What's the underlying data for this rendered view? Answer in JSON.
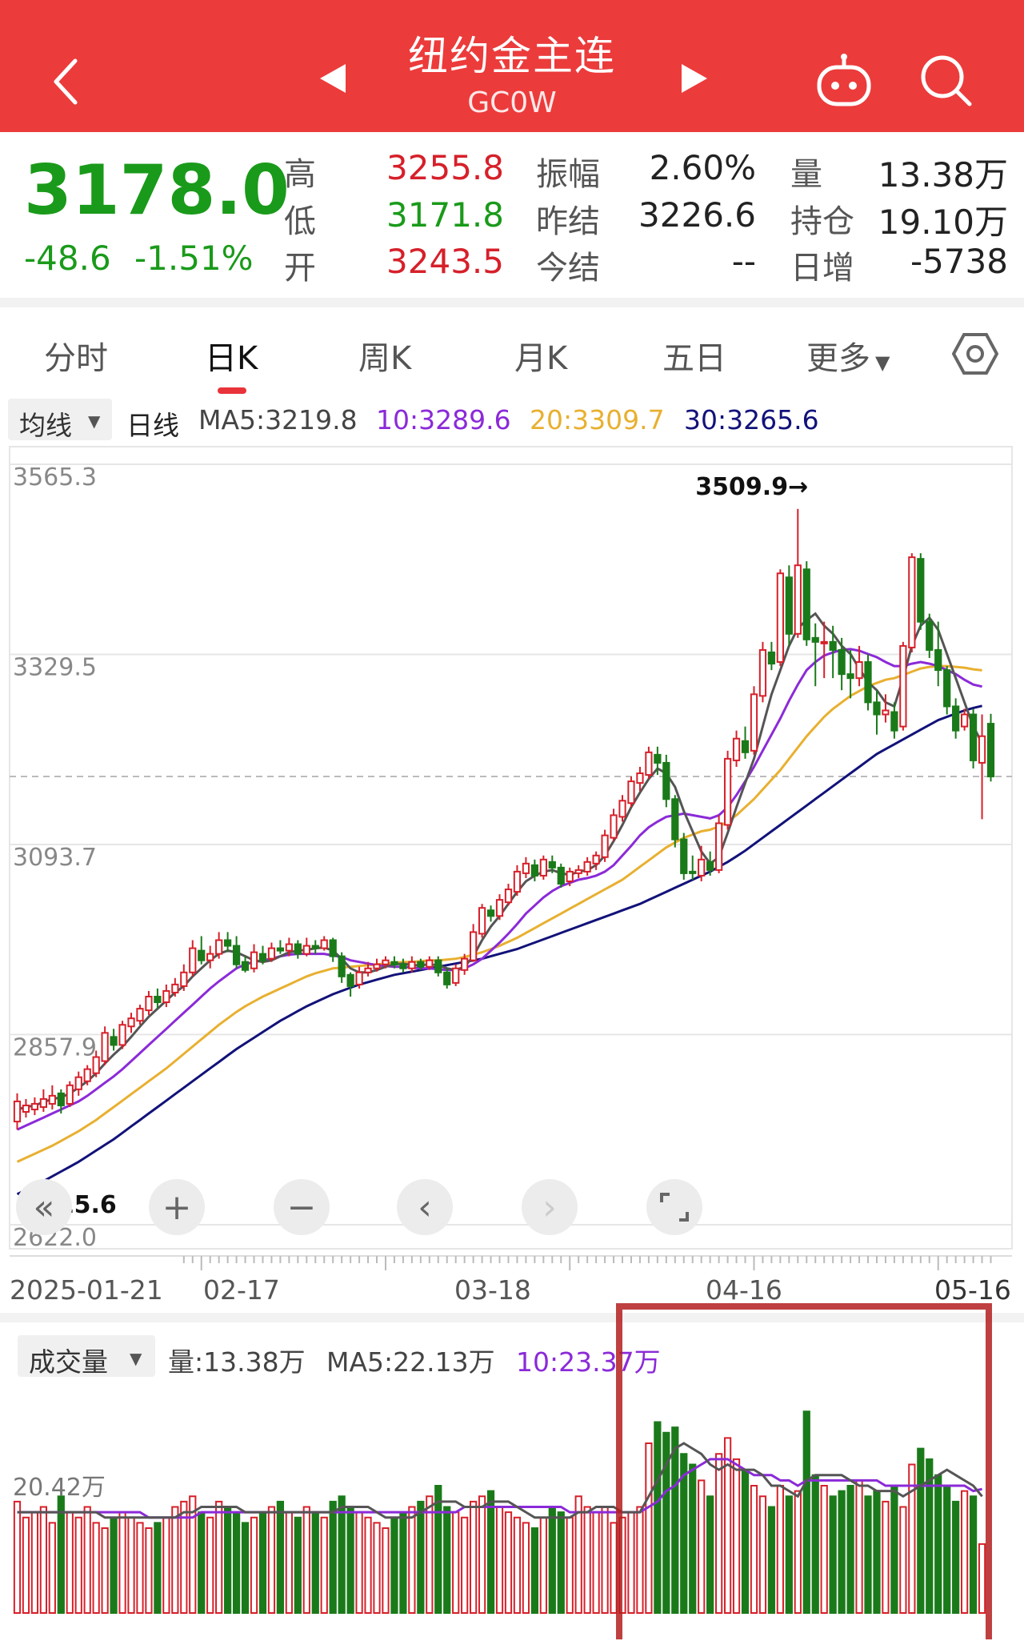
{
  "header": {
    "title": "纽约金主连",
    "code": "GC0W",
    "icons": [
      "back-icon",
      "prev-icon",
      "next-icon",
      "robot-icon",
      "search-icon"
    ]
  },
  "quote": {
    "price": "3178.0",
    "change": "-48.6",
    "change_pct": "-1.51%",
    "col1": [
      {
        "label": "高",
        "value": "3255.8",
        "color": "red"
      },
      {
        "label": "低",
        "value": "3171.8",
        "color": "green"
      },
      {
        "label": "开",
        "value": "3243.5",
        "color": "red"
      }
    ],
    "col2": [
      {
        "label": "振幅",
        "value": "2.60%"
      },
      {
        "label": "昨结",
        "value": "3226.6"
      },
      {
        "label": "今结",
        "value": "--"
      }
    ],
    "col3": [
      {
        "label": "量",
        "value": "13.38万"
      },
      {
        "label": "持仓",
        "value": "19.10万"
      },
      {
        "label": "日增",
        "value": "-5738"
      }
    ]
  },
  "tabs": [
    "分时",
    "日K",
    "周K",
    "月K",
    "五日",
    "更多"
  ],
  "active_tab": "日K",
  "ma_legend": {
    "selector": "均线",
    "period": "日线",
    "ma5": "MA5:3219.8",
    "ma10": "10:3289.6",
    "ma20": "20:3309.7",
    "ma30": "30:3265.6"
  },
  "colors": {
    "up": "#d6202a",
    "down": "#1a7a1a",
    "ma5": "#555555",
    "ma10": "#8b2ad8",
    "ma20": "#e8b030",
    "ma30": "#12127a",
    "header": "#ec3b3b"
  },
  "controls": [
    "rewind-icon",
    "zoom-in-icon",
    "zoom-out-icon",
    "left-icon",
    "right-icon",
    "fullscreen-icon"
  ],
  "volume_legend": {
    "selector": "成交量",
    "vol": "量:13.38万",
    "ma5": "MA5:22.13万",
    "ma10": "10:23.37万"
  },
  "chart_data": {
    "type": "candlestick",
    "y_ticks": [
      "3565.3",
      "3329.5",
      "3093.7",
      "2857.9",
      "2622.0"
    ],
    "ylim": [
      2622.0,
      3565.3
    ],
    "max_label": "3509.9→",
    "min_label": "2715.6",
    "last_close": 3178.0,
    "x_ticks": [
      "2025-01-21",
      "02-17",
      "03-18",
      "04-16",
      "05-16"
    ],
    "vol_axis_label": "20.42万",
    "candles": [
      [
        2750,
        2775,
        2740,
        2785
      ],
      [
        2762,
        2770,
        2755,
        2778
      ],
      [
        2765,
        2772,
        2758,
        2780
      ],
      [
        2768,
        2778,
        2762,
        2790
      ],
      [
        2772,
        2782,
        2765,
        2795
      ],
      [
        2785,
        2770,
        2760,
        2790
      ],
      [
        2772,
        2795,
        2768,
        2800
      ],
      [
        2790,
        2805,
        2782,
        2812
      ],
      [
        2800,
        2815,
        2795,
        2820
      ],
      [
        2810,
        2830,
        2805,
        2838
      ],
      [
        2825,
        2860,
        2820,
        2868
      ],
      [
        2855,
        2845,
        2838,
        2865
      ],
      [
        2845,
        2870,
        2840,
        2875
      ],
      [
        2868,
        2878,
        2860,
        2885
      ],
      [
        2875,
        2890,
        2870,
        2895
      ],
      [
        2888,
        2905,
        2882,
        2912
      ],
      [
        2905,
        2898,
        2890,
        2915
      ],
      [
        2898,
        2912,
        2892,
        2920
      ],
      [
        2910,
        2920,
        2905,
        2928
      ],
      [
        2918,
        2935,
        2912,
        2945
      ],
      [
        2935,
        2965,
        2930,
        2975
      ],
      [
        2962,
        2950,
        2945,
        2980
      ],
      [
        2950,
        2958,
        2940,
        2968
      ],
      [
        2958,
        2975,
        2952,
        2985
      ],
      [
        2975,
        2968,
        2960,
        2985
      ],
      [
        2968,
        2945,
        2940,
        2980
      ],
      [
        2948,
        2938,
        2935,
        2955
      ],
      [
        2940,
        2960,
        2935,
        2970
      ],
      [
        2958,
        2950,
        2945,
        2968
      ],
      [
        2952,
        2965,
        2948,
        2972
      ],
      [
        2965,
        2962,
        2958,
        2975
      ],
      [
        2962,
        2970,
        2955,
        2978
      ],
      [
        2970,
        2958,
        2952,
        2975
      ],
      [
        2958,
        2968,
        2955,
        2978
      ],
      [
        2968,
        2965,
        2958,
        2975
      ],
      [
        2965,
        2975,
        2962,
        2980
      ],
      [
        2975,
        2955,
        2948,
        2978
      ],
      [
        2955,
        2930,
        2922,
        2960
      ],
      [
        2932,
        2918,
        2905,
        2935
      ],
      [
        2920,
        2935,
        2915,
        2942
      ],
      [
        2935,
        2940,
        2930,
        2948
      ],
      [
        2940,
        2945,
        2936,
        2952
      ],
      [
        2945,
        2950,
        2940,
        2955
      ],
      [
        2948,
        2945,
        2940,
        2955
      ],
      [
        2945,
        2940,
        2935,
        2952
      ],
      [
        2940,
        2948,
        2935,
        2955
      ],
      [
        2948,
        2942,
        2938,
        2952
      ],
      [
        2942,
        2950,
        2938,
        2955
      ],
      [
        2950,
        2935,
        2930,
        2955
      ],
      [
        2935,
        2920,
        2915,
        2940
      ],
      [
        2922,
        2940,
        2918,
        2945
      ],
      [
        2938,
        2952,
        2932,
        2958
      ],
      [
        2950,
        2985,
        2948,
        2995
      ],
      [
        2983,
        3015,
        2978,
        3020
      ],
      [
        3012,
        3005,
        2998,
        3018
      ],
      [
        3005,
        3025,
        3000,
        3032
      ],
      [
        3022,
        3038,
        3018,
        3045
      ],
      [
        3035,
        3060,
        3030,
        3068
      ],
      [
        3058,
        3070,
        3052,
        3078
      ],
      [
        3068,
        3055,
        3048,
        3075
      ],
      [
        3055,
        3075,
        3050,
        3080
      ],
      [
        3072,
        3065,
        3058,
        3080
      ],
      [
        3065,
        3045,
        3040,
        3070
      ],
      [
        3048,
        3060,
        3042,
        3065
      ],
      [
        3058,
        3062,
        3052,
        3068
      ],
      [
        3060,
        3072,
        3055,
        3078
      ],
      [
        3070,
        3080,
        3062,
        3085
      ],
      [
        3078,
        3105,
        3072,
        3112
      ],
      [
        3102,
        3130,
        3098,
        3138
      ],
      [
        3128,
        3148,
        3122,
        3155
      ],
      [
        3145,
        3172,
        3140,
        3178
      ],
      [
        3170,
        3182,
        3160,
        3190
      ],
      [
        3180,
        3208,
        3175,
        3215
      ],
      [
        3205,
        3195,
        3180,
        3215
      ],
      [
        3195,
        3150,
        3140,
        3205
      ],
      [
        3150,
        3100,
        3090,
        3155
      ],
      [
        3100,
        3058,
        3050,
        3108
      ],
      [
        3060,
        3058,
        3050,
        3080
      ],
      [
        3055,
        3075,
        3048,
        3092
      ],
      [
        3072,
        3062,
        3055,
        3085
      ],
      [
        3062,
        3120,
        3058,
        3130
      ],
      [
        3118,
        3200,
        3112,
        3210
      ],
      [
        3198,
        3225,
        3190,
        3235
      ],
      [
        3222,
        3208,
        3200,
        3240
      ],
      [
        3210,
        3280,
        3205,
        3290
      ],
      [
        3278,
        3335,
        3270,
        3345
      ],
      [
        3332,
        3318,
        3310,
        3345
      ],
      [
        3320,
        3430,
        3315,
        3435
      ],
      [
        3425,
        3355,
        3340,
        3440
      ],
      [
        3355,
        3440,
        3350,
        3509.9
      ],
      [
        3435,
        3348,
        3340,
        3445
      ],
      [
        3350,
        3345,
        3290,
        3368
      ],
      [
        3345,
        3345,
        3300,
        3370
      ],
      [
        3345,
        3335,
        3300,
        3365
      ],
      [
        3335,
        3305,
        3285,
        3350
      ],
      [
        3305,
        3300,
        3275,
        3335
      ],
      [
        3300,
        3320,
        3290,
        3340
      ],
      [
        3320,
        3270,
        3260,
        3330
      ],
      [
        3270,
        3255,
        3230,
        3285
      ],
      [
        3255,
        3260,
        3245,
        3280
      ],
      [
        3258,
        3235,
        3225,
        3270
      ],
      [
        3240,
        3340,
        3235,
        3345
      ],
      [
        3338,
        3450,
        3332,
        3455
      ],
      [
        3448,
        3370,
        3360,
        3455
      ],
      [
        3370,
        3335,
        3325,
        3380
      ],
      [
        3335,
        3310,
        3290,
        3370
      ],
      [
        3310,
        3265,
        3255,
        3315
      ],
      [
        3265,
        3235,
        3225,
        3275
      ],
      [
        3240,
        3255,
        3235,
        3262
      ],
      [
        3255,
        3198,
        3188,
        3262
      ],
      [
        3195,
        3228,
        3125,
        3255
      ],
      [
        3243.5,
        3178,
        3171.8,
        3255.8
      ]
    ],
    "ma5": [
      2765,
      2768,
      2770,
      2774,
      2778,
      2780,
      2785,
      2792,
      2800,
      2810,
      2822,
      2833,
      2843,
      2855,
      2868,
      2880,
      2890,
      2900,
      2910,
      2918,
      2930,
      2940,
      2950,
      2958,
      2962,
      2960,
      2955,
      2950,
      2948,
      2950,
      2955,
      2960,
      2962,
      2963,
      2965,
      2966,
      2962,
      2952,
      2940,
      2935,
      2935,
      2938,
      2942,
      2945,
      2946,
      2944,
      2944,
      2945,
      2944,
      2940,
      2938,
      2942,
      2955,
      2975,
      2992,
      3005,
      3020,
      3035,
      3048,
      3055,
      3060,
      3062,
      3058,
      3056,
      3060,
      3062,
      3068,
      3080,
      3098,
      3118,
      3140,
      3158,
      3175,
      3188,
      3182,
      3165,
      3135,
      3110,
      3085,
      3070,
      3078,
      3108,
      3140,
      3170,
      3200,
      3240,
      3280,
      3310,
      3340,
      3362,
      3372,
      3380,
      3365,
      3355,
      3340,
      3330,
      3312,
      3295,
      3285,
      3270,
      3265,
      3300,
      3340,
      3365,
      3375,
      3360,
      3330,
      3300,
      3270,
      3240,
      3219.8
    ],
    "ma10": [
      2740,
      2745,
      2750,
      2755,
      2760,
      2765,
      2770,
      2775,
      2782,
      2790,
      2798,
      2806,
      2815,
      2825,
      2835,
      2845,
      2855,
      2865,
      2875,
      2885,
      2895,
      2905,
      2915,
      2924,
      2932,
      2940,
      2945,
      2948,
      2950,
      2952,
      2955,
      2957,
      2958,
      2958,
      2958,
      2958,
      2956,
      2954,
      2950,
      2948,
      2946,
      2944,
      2943,
      2942,
      2942,
      2941,
      2940,
      2940,
      2939,
      2938,
      2938,
      2940,
      2945,
      2952,
      2962,
      2972,
      2983,
      2995,
      3008,
      3018,
      3028,
      3036,
      3042,
      3046,
      3050,
      3052,
      3055,
      3060,
      3068,
      3080,
      3092,
      3105,
      3115,
      3122,
      3128,
      3130,
      3132,
      3130,
      3128,
      3126,
      3130,
      3140,
      3155,
      3172,
      3190,
      3210,
      3230,
      3250,
      3272,
      3292,
      3310,
      3320,
      3328,
      3332,
      3335,
      3336,
      3334,
      3330,
      3326,
      3320,
      3315,
      3315,
      3318,
      3320,
      3318,
      3315,
      3310,
      3305,
      3298,
      3292,
      3289.6
    ],
    "ma20": [
      2700,
      2705,
      2710,
      2715,
      2720,
      2726,
      2732,
      2738,
      2745,
      2752,
      2760,
      2768,
      2776,
      2784,
      2792,
      2800,
      2808,
      2816,
      2825,
      2834,
      2843,
      2852,
      2861,
      2870,
      2878,
      2886,
      2893,
      2899,
      2905,
      2910,
      2915,
      2920,
      2925,
      2930,
      2934,
      2937,
      2940,
      2941,
      2942,
      2943,
      2944,
      2945,
      2946,
      2947,
      2948,
      2948,
      2949,
      2950,
      2950,
      2951,
      2952,
      2954,
      2957,
      2960,
      2964,
      2968,
      2973,
      2978,
      2984,
      2990,
      2996,
      3002,
      3008,
      3014,
      3020,
      3026,
      3032,
      3038,
      3044,
      3050,
      3058,
      3066,
      3074,
      3082,
      3090,
      3096,
      3102,
      3106,
      3110,
      3112,
      3116,
      3122,
      3130,
      3140,
      3150,
      3162,
      3174,
      3186,
      3200,
      3214,
      3228,
      3240,
      3252,
      3262,
      3270,
      3278,
      3284,
      3290,
      3294,
      3298,
      3300,
      3304,
      3308,
      3312,
      3314,
      3315,
      3315,
      3314,
      3313,
      3311,
      3309.7
    ],
    "ma30": [
      2660,
      2665,
      2670,
      2676,
      2682,
      2688,
      2694,
      2700,
      2707,
      2714,
      2721,
      2728,
      2736,
      2744,
      2752,
      2760,
      2768,
      2776,
      2784,
      2792,
      2800,
      2808,
      2816,
      2824,
      2832,
      2840,
      2847,
      2854,
      2861,
      2868,
      2875,
      2881,
      2887,
      2893,
      2898,
      2903,
      2908,
      2912,
      2916,
      2920,
      2923,
      2926,
      2929,
      2932,
      2934,
      2936,
      2938,
      2940,
      2942,
      2944,
      2946,
      2948,
      2950,
      2952,
      2955,
      2958,
      2961,
      2964,
      2968,
      2972,
      2976,
      2980,
      2984,
      2988,
      2992,
      2996,
      3000,
      3004,
      3008,
      3012,
      3016,
      3020,
      3025,
      3030,
      3035,
      3040,
      3045,
      3050,
      3055,
      3060,
      3066,
      3072,
      3079,
      3086,
      3094,
      3102,
      3110,
      3118,
      3126,
      3134,
      3142,
      3150,
      3158,
      3166,
      3174,
      3182,
      3190,
      3198,
      3206,
      3212,
      3218,
      3224,
      3230,
      3236,
      3242,
      3248,
      3252,
      3256,
      3260,
      3263,
      3265.6
    ],
    "volumes": [
      21,
      18,
      19,
      20,
      17,
      22,
      19,
      18,
      20,
      17,
      16,
      18,
      19,
      18,
      17,
      16,
      17,
      18,
      20,
      21,
      22,
      19,
      18,
      21,
      20,
      19,
      17,
      18,
      19,
      20,
      21,
      19,
      18,
      20,
      19,
      18,
      21,
      22,
      20,
      19,
      18,
      17,
      16,
      18,
      19,
      20,
      21,
      22,
      24,
      20,
      19,
      18,
      21,
      22,
      23,
      20,
      19,
      18,
      17,
      16,
      18,
      20,
      19,
      18,
      22,
      20,
      19,
      20,
      17,
      18,
      19,
      20,
      32,
      36,
      34,
      35,
      30,
      28,
      25,
      22,
      30,
      33,
      29,
      27,
      24,
      22,
      20,
      24,
      22,
      23,
      38,
      26,
      24,
      22,
      23,
      24,
      25,
      22,
      23,
      21,
      24,
      20,
      28,
      31,
      29,
      26,
      24,
      21,
      23,
      22,
      13
    ],
    "vol_ma5": [
      19,
      19,
      19,
      19,
      19,
      19,
      19,
      19,
      19,
      19,
      18,
      18,
      18,
      18,
      18,
      18,
      18,
      18,
      18,
      19,
      19,
      20,
      20,
      20,
      20,
      20,
      19,
      19,
      19,
      19,
      19,
      19,
      19,
      19,
      19,
      19,
      19,
      20,
      20,
      20,
      20,
      19,
      18,
      18,
      18,
      18,
      19,
      20,
      21,
      21,
      21,
      20,
      20,
      20,
      21,
      21,
      21,
      20,
      19,
      18,
      18,
      18,
      18,
      18,
      19,
      19,
      20,
      20,
      20,
      19,
      19,
      19,
      22,
      25,
      28,
      31,
      32,
      31,
      30,
      28,
      27,
      28,
      27,
      27,
      27,
      26,
      24,
      24,
      23,
      22,
      25,
      26,
      26,
      26,
      26,
      25,
      24,
      24,
      23,
      23,
      23,
      22,
      23,
      24,
      25,
      26,
      27,
      26,
      25,
      24,
      22
    ],
    "vol_ma10": [
      19,
      19,
      19,
      19,
      19,
      19,
      19,
      19,
      19,
      19,
      19,
      19,
      19,
      19,
      19,
      18,
      18,
      18,
      18,
      18,
      18,
      19,
      19,
      19,
      19,
      19,
      19,
      19,
      19,
      19,
      19,
      19,
      19,
      19,
      19,
      19,
      19,
      19,
      19,
      19,
      19,
      19,
      19,
      19,
      19,
      19,
      19,
      19,
      19,
      19,
      19,
      20,
      20,
      20,
      20,
      20,
      20,
      20,
      20,
      20,
      20,
      20,
      20,
      19,
      19,
      19,
      19,
      19,
      19,
      19,
      19,
      19,
      20,
      21,
      23,
      24,
      26,
      27,
      28,
      29,
      29,
      29,
      28,
      27,
      26,
      26,
      26,
      25,
      25,
      24,
      25,
      25,
      25,
      25,
      25,
      25,
      25,
      25,
      25,
      24,
      24,
      24,
      24,
      24,
      24,
      24,
      24,
      24,
      24,
      23,
      23.37
    ]
  }
}
